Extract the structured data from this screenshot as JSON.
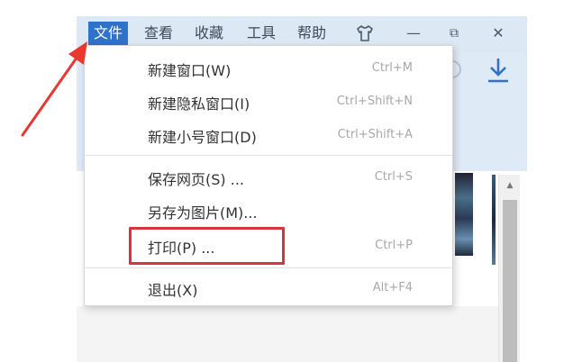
{
  "menubar": {
    "items": [
      {
        "label": "文件",
        "active": true
      },
      {
        "label": "查看"
      },
      {
        "label": "收藏"
      },
      {
        "label": "工具"
      },
      {
        "label": "帮助"
      }
    ],
    "window_buttons": {
      "minimize": "—",
      "restore": "⧉",
      "close": "✕"
    }
  },
  "file_menu": {
    "groups": [
      [
        {
          "label": "新建窗口(W)",
          "shortcut": "Ctrl+M"
        },
        {
          "label": "新建隐私窗口(I)",
          "shortcut": "Ctrl+Shift+N"
        },
        {
          "label": "新建小号窗口(D)",
          "shortcut": "Ctrl+Shift+A"
        }
      ],
      [
        {
          "label": "保存网页(S) ...",
          "shortcut": "Ctrl+S"
        },
        {
          "label": "另存为图片(M)...",
          "shortcut": ""
        },
        {
          "label": "打印(P) ...",
          "shortcut": "Ctrl+P",
          "highlighted": true
        }
      ],
      [
        {
          "label": "退出(X)",
          "shortcut": "Alt+F4"
        }
      ]
    ]
  },
  "colors": {
    "accent": "#2f72cc",
    "highlight_border": "#d9343b",
    "arrow": "#e8382f",
    "toolbar_bg": "#dfeaf7"
  },
  "icons": [
    "shirt-icon",
    "download-icon",
    "scroll-up-icon"
  ]
}
